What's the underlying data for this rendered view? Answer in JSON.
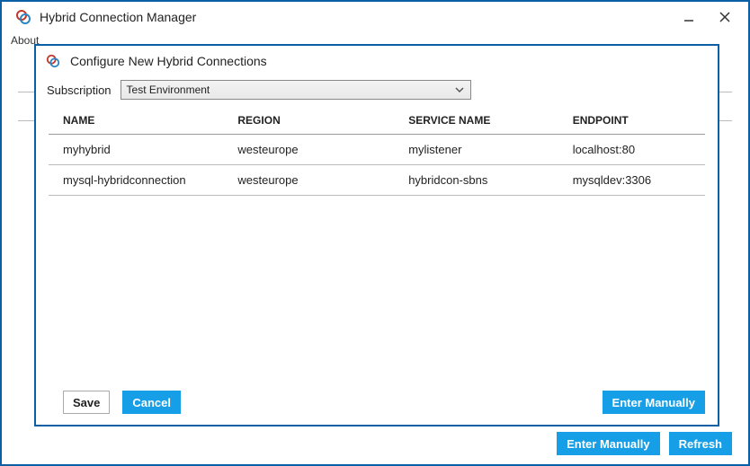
{
  "window": {
    "title": "Hybrid Connection Manager"
  },
  "menu": {
    "about": "About"
  },
  "dialog": {
    "title": "Configure New Hybrid Connections",
    "subscription_label": "Subscription",
    "subscription_value": "Test Environment",
    "columns": {
      "name": "NAME",
      "region": "REGION",
      "service": "SERVICE NAME",
      "endpoint": "ENDPOINT"
    },
    "rows": [
      {
        "name": "myhybrid",
        "region": "westeurope",
        "service": "mylistener",
        "endpoint": "localhost:80"
      },
      {
        "name": "mysql-hybridconnection",
        "region": "westeurope",
        "service": "hybridcon-sbns",
        "endpoint": "mysqldev:3306"
      }
    ],
    "buttons": {
      "save": "Save",
      "cancel": "Cancel",
      "enter_manually": "Enter Manually"
    }
  },
  "outer_buttons": {
    "enter_manually": "Enter Manually",
    "refresh": "Refresh"
  }
}
